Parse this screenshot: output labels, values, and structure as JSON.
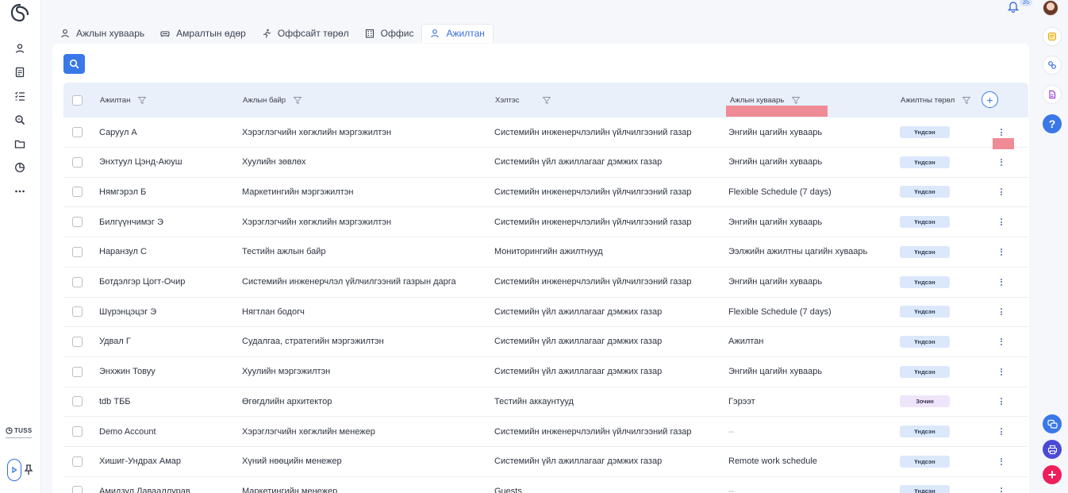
{
  "notifications": {
    "count": "35"
  },
  "brand": {
    "footer_logo": "TUSS"
  },
  "tabs": [
    {
      "label": "Ажлын хуваарь",
      "icon": "user-icon",
      "active": false
    },
    {
      "label": "Амралтын өдөр",
      "icon": "couch-icon",
      "active": false
    },
    {
      "label": "Оффсайт төрөл",
      "icon": "running-person-icon",
      "active": false
    },
    {
      "label": "Оффис",
      "icon": "building-icon",
      "active": false
    },
    {
      "label": "Ажилтан",
      "icon": "user-icon",
      "active": true
    }
  ],
  "table": {
    "columns": [
      "Ажилтан",
      "Ажлын байр",
      "Хэлтэс",
      "Ажлын хуваарь",
      "Ажилтны төрөл"
    ],
    "add_column": "+",
    "rows": [
      {
        "name": "Саруул А",
        "position": "Хэрэглэгчийн хөгжлийн мэргэжилтэн",
        "department": "Системийн инженерчлэлийн үйлчилгээний газар",
        "schedule": "Энгийн цагийн хуваарь",
        "type": "Үндсэн",
        "type_kind": "main"
      },
      {
        "name": "Энхтуул Цэнд-Аюуш",
        "position": "Хуулийн зөвлөх",
        "department": "Системийн үйл ажиллагааг дэмжих газар",
        "schedule": "Энгийн цагийн хуваарь",
        "type": "Үндсэн",
        "type_kind": "main"
      },
      {
        "name": "Нямгэрэл Б",
        "position": "Маркетингийн мэргэжилтэн",
        "department": "Системийн инженерчлэлийн үйлчилгээний газар",
        "schedule": "Flexible Schedule (7 days)",
        "type": "Үндсэн",
        "type_kind": "main"
      },
      {
        "name": "Билгүүнчимэг Э",
        "position": "Хэрэглэгчийн хөгжлийн мэргэжилтэн",
        "department": "Системийн инженерчлэлийн үйлчилгээний газар",
        "schedule": "Энгийн цагийн хуваарь",
        "type": "Үндсэн",
        "type_kind": "main"
      },
      {
        "name": "Наранзул С",
        "position": "Тестийн ажлын байр",
        "department": "Мониторингийн ажилтнууд",
        "schedule": "Ээлжийн ажилтны цагийн хуваарь",
        "type": "Үндсэн",
        "type_kind": "main"
      },
      {
        "name": "Ботдэлгэр Цогт-Очир",
        "position": "Системийн инженерчлэл үйлчилгээний газрын дарга",
        "department": "Системийн инженерчлэлийн үйлчилгээний газар",
        "schedule": "Энгийн цагийн хуваарь",
        "type": "Үндсэн",
        "type_kind": "main"
      },
      {
        "name": "Шүрэнцэцэг Э",
        "position": "Нягтлан бодогч",
        "department": "Системийн үйл ажиллагааг дэмжих газар",
        "schedule": "Flexible Schedule (7 days)",
        "type": "Үндсэн",
        "type_kind": "main"
      },
      {
        "name": "Удвал Г",
        "position": "Судалгаа, стратегийн мэргэжилтэн",
        "department": "Системийн үйл ажиллагааг дэмжих газар",
        "schedule": "Ажилтан",
        "type": "Үндсэн",
        "type_kind": "main"
      },
      {
        "name": "Энхжин Товуу",
        "position": "Хуулийн мэргэжилтэн",
        "department": "Системийн үйл ажиллагааг дэмжих газар",
        "schedule": "Энгийн цагийн хуваарь",
        "type": "Үндсэн",
        "type_kind": "main"
      },
      {
        "name": "tdb ТББ",
        "position": "Өгөгдлийн архитектор",
        "department": "Тестийн аккаунтууд",
        "schedule": "Гэрээт",
        "type": "Зочин",
        "type_kind": "alt"
      },
      {
        "name": "Demo Account",
        "position": "Хэрэглэгчийн хөгжлийн менежер",
        "department": "Системийн инженерчлэлийн үйлчилгээний газар",
        "schedule": "--",
        "type": "Үндсэн",
        "type_kind": "main"
      },
      {
        "name": "Хишиг-Ундрах Амар",
        "position": "Хүний нөөцийн менежер",
        "department": "Системийн үйл ажиллагааг дэмжих газар",
        "schedule": "Remote work schedule",
        "type": "Үндсэн",
        "type_kind": "main"
      },
      {
        "name": "Амидзул Лавааллурав",
        "position": "Маркетингийн менежер",
        "department": "Guests",
        "schedule": "--",
        "type": "Үндсэн",
        "type_kind": "main"
      }
    ]
  },
  "colors": {
    "accent": "#3a78e8",
    "highlight_marker": "#ef8b95",
    "help": "#3a78e8",
    "fab_add": "#ee1f5a",
    "fab_print": "#4a4ad8"
  }
}
